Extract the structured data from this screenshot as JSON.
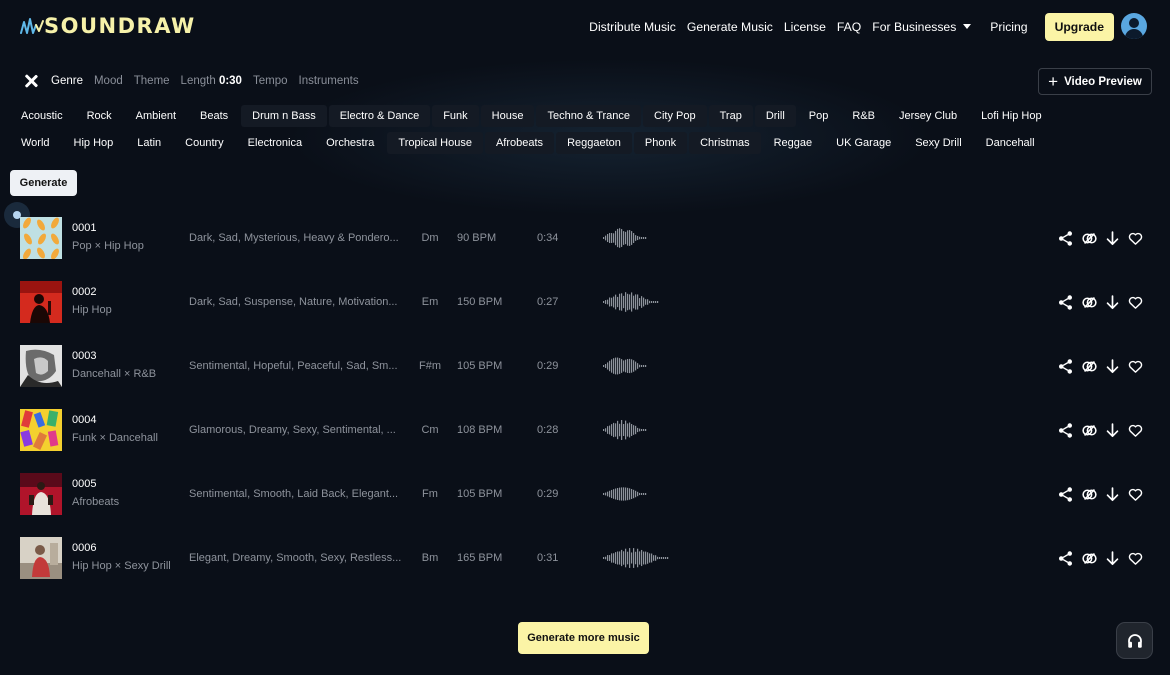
{
  "brand": {
    "name": "SOUNDRAW",
    "logo_color": "#f6f1a9"
  },
  "nav": {
    "links": [
      "Distribute Music",
      "Generate Music",
      "License",
      "FAQ",
      "For Businesses",
      "Pricing"
    ],
    "upgrade": "Upgrade",
    "accent": "#fbf4a6"
  },
  "filters": {
    "tabs": [
      "Genre",
      "Mood",
      "Theme"
    ],
    "length_label": "Length",
    "length_value": "0:30",
    "tabs_after": [
      "Tempo",
      "Instruments"
    ],
    "active_tab": "Genre",
    "video_preview": "Video Preview"
  },
  "genres": {
    "row1": [
      "Acoustic",
      "Rock",
      "Ambient",
      "Beats",
      "Drum n Bass",
      "Electro & Dance",
      "Funk",
      "House",
      "Techno & Trance",
      "City Pop",
      "Trap",
      "Drill",
      "Pop",
      "R&B",
      "Jersey Club",
      "Lofi Hip Hop"
    ],
    "row2": [
      "World",
      "Hip Hop",
      "Latin",
      "Country",
      "Electronica",
      "Orchestra",
      "Tropical House",
      "Afrobeats",
      "Reggaeton",
      "Phonk",
      "Christmas",
      "Reggae",
      "UK Garage",
      "Sexy Drill",
      "Dancehall"
    ],
    "highlighted": [
      "Drum n Bass",
      "Electro & Dance",
      "Funk",
      "House",
      "Techno & Trance",
      "City Pop",
      "Trap",
      "Drill",
      "Tropical House",
      "Afrobeats",
      "Reggaeton",
      "Phonk",
      "Christmas"
    ]
  },
  "generate_label": "Generate",
  "tracks": [
    {
      "number": "0001",
      "genre": "Pop × Hip Hop",
      "moods": "Dark, Sad, Mysterious, Heavy & Pondero...",
      "key": "Dm",
      "bpm": "90 BPM",
      "length": "0:34"
    },
    {
      "number": "0002",
      "genre": "Hip Hop",
      "moods": "Dark, Sad, Suspense, Nature, Motivation...",
      "key": "Em",
      "bpm": "150 BPM",
      "length": "0:27"
    },
    {
      "number": "0003",
      "genre": "Dancehall × R&B",
      "moods": "Sentimental, Hopeful, Peaceful, Sad, Sm...",
      "key": "F#m",
      "bpm": "105 BPM",
      "length": "0:29"
    },
    {
      "number": "0004",
      "genre": "Funk × Dancehall",
      "moods": "Glamorous, Dreamy, Sexy, Sentimental, ...",
      "key": "Cm",
      "bpm": "108 BPM",
      "length": "0:28"
    },
    {
      "number": "0005",
      "genre": "Afrobeats",
      "moods": "Sentimental, Smooth, Laid Back, Elegant...",
      "key": "Fm",
      "bpm": "105 BPM",
      "length": "0:29"
    },
    {
      "number": "0006",
      "genre": "Hip Hop × Sexy Drill",
      "moods": "Elegant, Dreamy, Smooth, Sexy, Restless...",
      "key": "Bm",
      "bpm": "165 BPM",
      "length": "0:31"
    }
  ],
  "actions": {
    "icons": [
      "share-icon",
      "remix-icon",
      "download-icon",
      "heart-icon"
    ]
  },
  "generate_more": "Generate more music",
  "support_icon": "headphones-icon"
}
